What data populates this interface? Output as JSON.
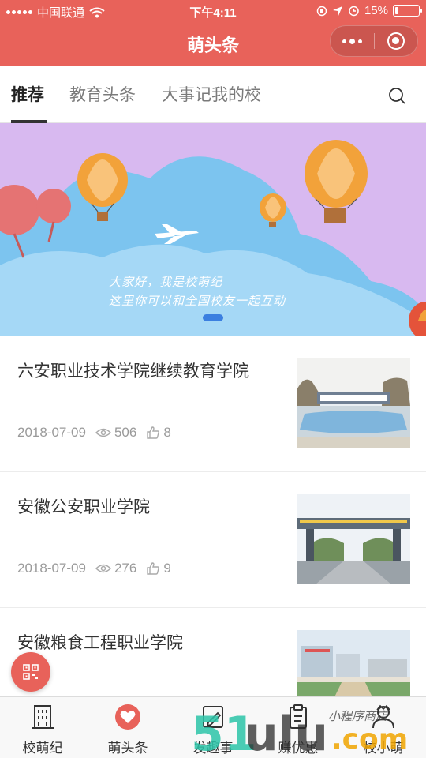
{
  "status_bar": {
    "carrier": "中国联通",
    "time": "下午4:11",
    "battery": "15%",
    "battery_level": 0.15
  },
  "navbar": {
    "title": "萌头条",
    "more_icon": "more-dots-icon",
    "close_icon": "target-close-icon"
  },
  "tabs": [
    {
      "label": "推荐",
      "active": true
    },
    {
      "label": "教育头条",
      "active": false
    },
    {
      "label": "大事记我的校",
      "active": false
    }
  ],
  "banner": {
    "line1": "大家好，我是校萌纪",
    "line2": "这里你可以和全国校友一起互动"
  },
  "articles": [
    {
      "title": "六安职业技术学院继续教育学院",
      "date": "2018-07-09",
      "views": "506",
      "likes": "8"
    },
    {
      "title": "安徽公安职业学院",
      "date": "2018-07-09",
      "views": "276",
      "likes": "9"
    },
    {
      "title": "安徽粮食工程职业学院"
    }
  ],
  "tabbar": [
    {
      "label": "校萌纪",
      "icon": "building-icon"
    },
    {
      "label": "萌头条",
      "icon": "heart-icon",
      "active": true
    },
    {
      "label": "发趣事",
      "icon": "pencil-icon"
    },
    {
      "label": "赚优惠",
      "icon": "clipboard-icon"
    },
    {
      "label": "校小萌",
      "icon": "person-icon"
    }
  ],
  "watermark": {
    "brand": "51ulu.com",
    "script": "小程序商店"
  },
  "colors": {
    "primary": "#e8625a",
    "banner_bg": "#d8b9f0",
    "cloud": "#7cc4ef"
  }
}
